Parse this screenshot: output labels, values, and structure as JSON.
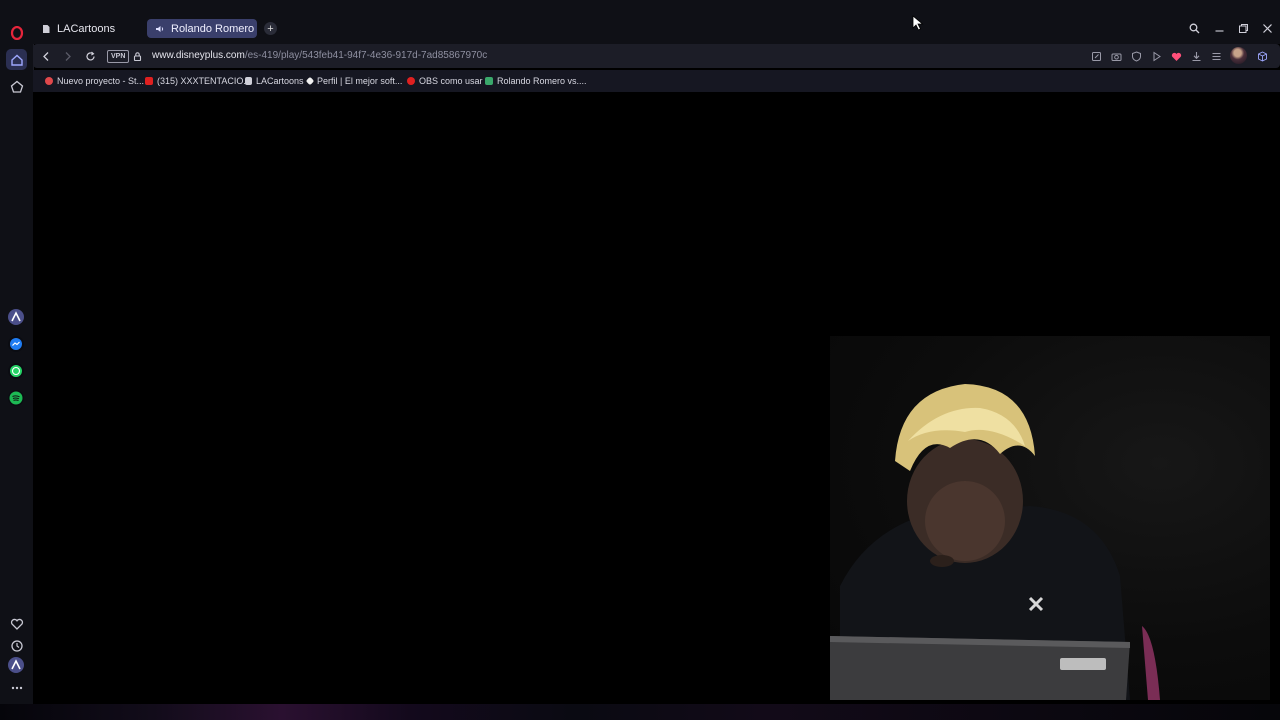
{
  "tabs": [
    {
      "label": "LACartoons",
      "icon": "document-icon",
      "active": false
    },
    {
      "label": "Rolando Romero vs. T",
      "icon": "speaker-icon",
      "active": true
    }
  ],
  "new_tab_label": "+",
  "address_bar": {
    "vpn_label": "VPN",
    "url_domain": "www.disneyplus.com",
    "url_path": "/es-419/play/543feb41-94f7-4e36-917d-7ad85867970c"
  },
  "bookmarks": [
    {
      "label": "Nuevo proyecto - St...",
      "color": "#e0484b"
    },
    {
      "label": "(315) XXXTENTACIO...",
      "color": "#e02020"
    },
    {
      "label": "LACartoons",
      "color": "#cfcfd8"
    },
    {
      "label": "Perfil | El mejor soft...",
      "color": "#f0f0f0"
    },
    {
      "label": "OBS como usar",
      "color": "#e02020"
    },
    {
      "label": "Rolando Romero vs....",
      "color": "#3aa86b"
    }
  ],
  "sidebar_apps": [
    {
      "name": "aria",
      "color": "#6a5bd6"
    },
    {
      "name": "messenger",
      "color": "#1f7cf2"
    },
    {
      "name": "whatsapp",
      "color": "#25d366"
    },
    {
      "name": "spotify",
      "color": "#1db954"
    }
  ],
  "colors": {
    "opera_red": "#e6253b",
    "accent": "#3a3f6b",
    "heart": "#ff4f7a"
  }
}
